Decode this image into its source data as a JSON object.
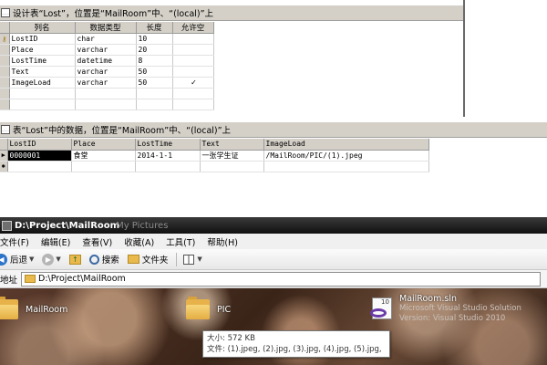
{
  "design_panel": {
    "title": "设计表“Lost”，位置是“MailRoom”中、“(local)”上",
    "headers": [
      "列名",
      "数据类型",
      "长度",
      "允许空"
    ],
    "rows": [
      {
        "name": "LostID",
        "type": "char",
        "length": "10",
        "nullable": "",
        "key": true
      },
      {
        "name": "Place",
        "type": "varchar",
        "length": "20",
        "nullable": "",
        "key": false
      },
      {
        "name": "LostTime",
        "type": "datetime",
        "length": "8",
        "nullable": "",
        "key": false
      },
      {
        "name": "Text",
        "type": "varchar",
        "length": "50",
        "nullable": "",
        "key": false
      },
      {
        "name": "ImageLoad",
        "type": "varchar",
        "length": "50",
        "nullable": "✓",
        "key": false
      }
    ],
    "key_icon": "primary-key-icon"
  },
  "data_panel": {
    "title": "表“Lost”中的数据，位置是“MailRoom”中、“(local)”上",
    "headers": [
      "LostID",
      "Place",
      "LostTime",
      "Text",
      "ImageLoad"
    ],
    "rows": [
      {
        "LostID": "0000001",
        "Place": "食堂",
        "LostTime": "2014-1-1",
        "Text": "一张学生证",
        "ImageLoad": "/MailRoom/PIC/(1).jpeg"
      }
    ],
    "current_row_marker": "▶",
    "new_row_marker": "✱"
  },
  "explorer": {
    "title": "D:\\Project\\MailRoom",
    "title_ghost": "My Pictures",
    "menu": [
      "文件(F)",
      "编辑(E)",
      "查看(V)",
      "收藏(A)",
      "工具(T)",
      "帮助(H)"
    ],
    "toolbar": {
      "back_label": "后退",
      "search_label": "搜索",
      "folders_label": "文件夹"
    },
    "address": {
      "label": "地址",
      "value": "D:\\Project\\MailRoom"
    },
    "items": [
      {
        "name": "MailRoom",
        "kind": "folder"
      },
      {
        "name": "PIC",
        "kind": "folder"
      },
      {
        "name": "MailRoom.sln",
        "kind": "solution",
        "subtitle1": "Microsoft Visual Studio Solution",
        "subtitle2": "Version: Visual Studio 2010",
        "icon_version": "10"
      }
    ],
    "tooltip": {
      "size_line": "大小: 572 KB",
      "files_line": "文件: (1).jpeg, (2).jpg, (3).jpg, (4).jpg, (5).jpg, ..."
    }
  },
  "colors": {
    "chrome": "#d4d0c8",
    "title_dark": "#1a1a1a",
    "folder": "#e7b24a"
  }
}
